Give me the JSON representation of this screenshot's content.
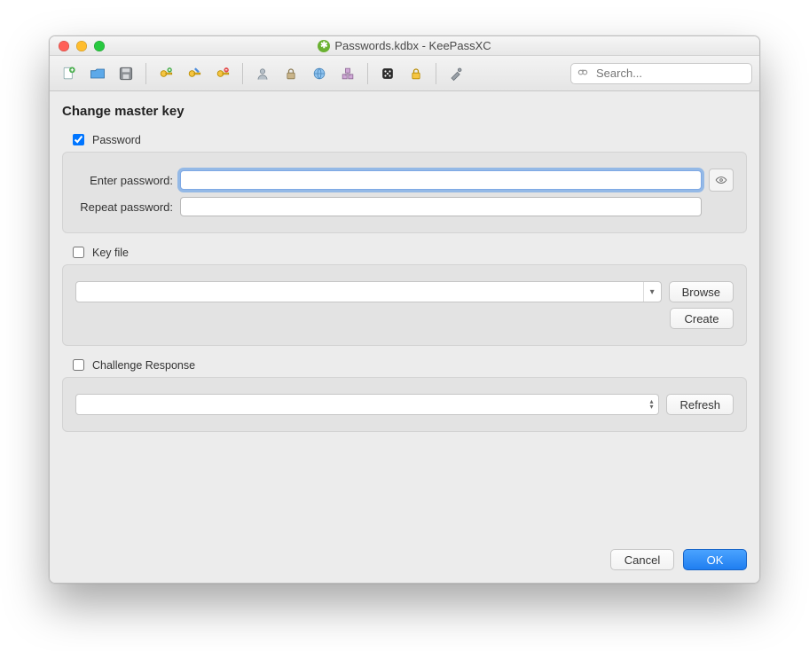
{
  "window": {
    "title": "Passwords.kdbx - KeePassXC"
  },
  "search": {
    "placeholder": "Search..."
  },
  "page": {
    "title": "Change master key"
  },
  "sections": {
    "password": {
      "label": "Password",
      "checked": true,
      "enter_label": "Enter password:",
      "repeat_label": "Repeat password:",
      "enter_value": "",
      "repeat_value": ""
    },
    "keyfile": {
      "label": "Key file",
      "checked": false,
      "path_value": "",
      "browse_label": "Browse",
      "create_label": "Create"
    },
    "challenge": {
      "label": "Challenge Response",
      "checked": false,
      "selected": "",
      "refresh_label": "Refresh"
    }
  },
  "footer": {
    "cancel": "Cancel",
    "ok": "OK"
  },
  "toolbar_icons": {
    "new_db": "new-database-icon",
    "open_db": "open-database-icon",
    "save_db": "save-database-icon",
    "add_entry": "add-entry-icon",
    "edit_entry": "edit-entry-icon",
    "delete_entry": "delete-entry-icon",
    "copy_user": "copy-username-icon",
    "copy_pass": "copy-password-icon",
    "copy_url": "copy-url-icon",
    "autotype": "autotype-icon",
    "generator": "password-generator-icon",
    "lock": "lock-database-icon",
    "settings": "settings-icon"
  }
}
